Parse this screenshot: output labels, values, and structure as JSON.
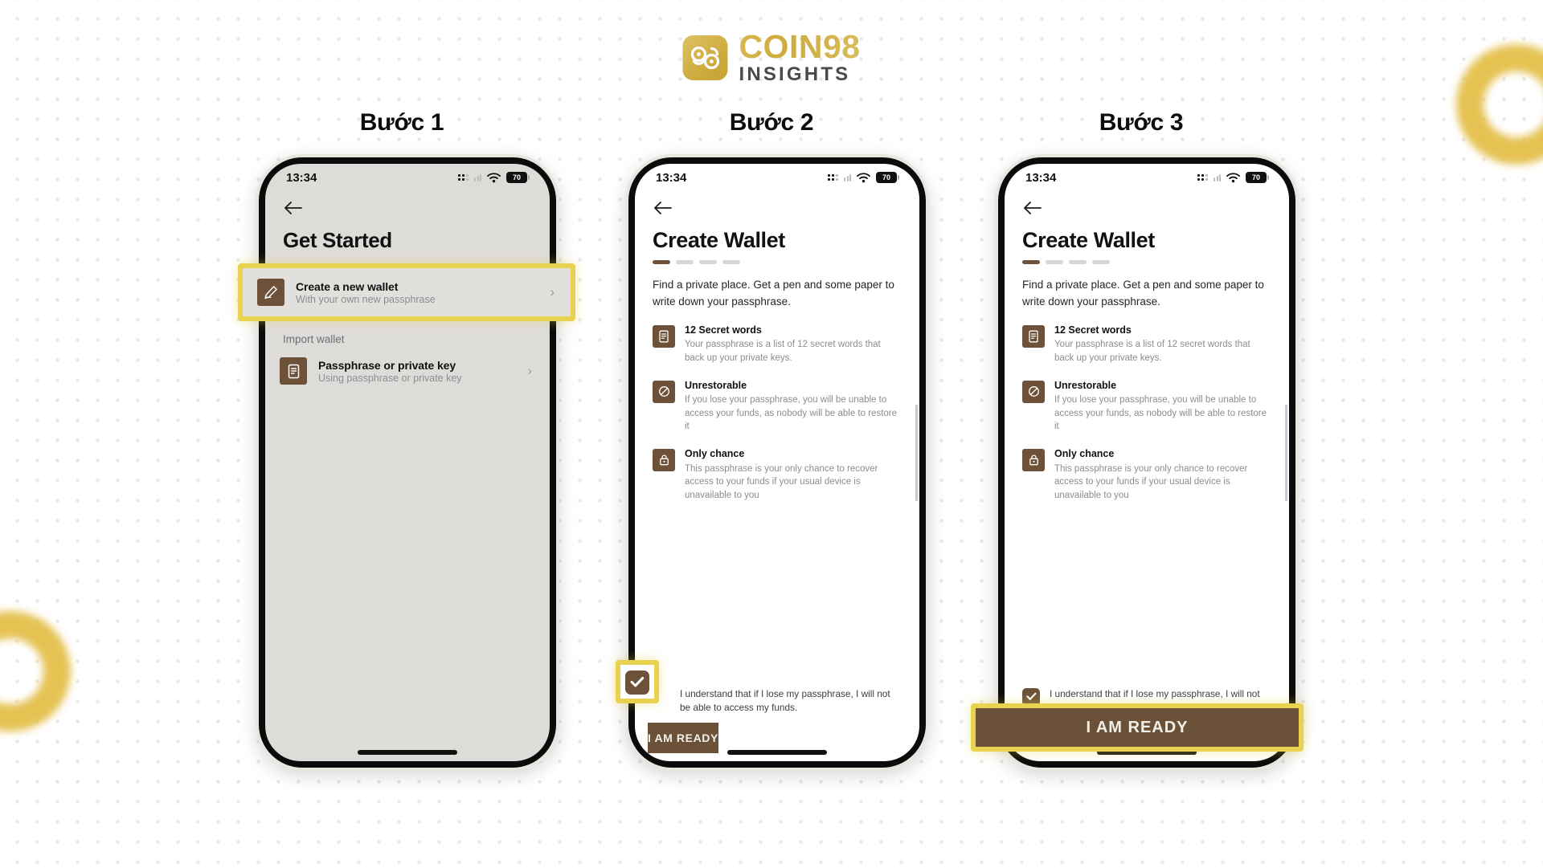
{
  "brand": {
    "name": "COIN98",
    "subtitle": "INSIGHTS",
    "logo_icon": "coin98-logo-icon",
    "gold": "#cfac3f"
  },
  "colors": {
    "brown": "#6d5239",
    "cta_brown": "#6b5138",
    "highlight_yellow": "#e9d24f",
    "screen_gray": "#dedcd8",
    "muted_text": "#8c8c92"
  },
  "steps": [
    {
      "label": "Bước 1"
    },
    {
      "label": "Bước 2"
    },
    {
      "label": "Bước 3"
    }
  ],
  "status_bar": {
    "time": "13:34",
    "battery": "70",
    "signal_icon": "signal-dots-icon",
    "wifi_icon": "wifi-icon",
    "battery_icon": "battery-icon"
  },
  "screen1": {
    "back_icon": "back-arrow-icon",
    "title": "Get Started",
    "primary_row": {
      "icon": "pencil-icon",
      "title": "Create a new wallet",
      "subtitle": "With your own new passphrase",
      "chevron": "›"
    },
    "section_label": "Import wallet",
    "import_row": {
      "icon": "document-icon",
      "title": "Passphrase or private key",
      "subtitle": "Using passphrase or private key",
      "chevron": "›"
    }
  },
  "screen2": {
    "back_icon": "back-arrow-icon",
    "title": "Create Wallet",
    "progress": {
      "total": 4,
      "active": 1
    },
    "intro": "Find a private place. Get a pen and some paper to write down your passphrase.",
    "features": [
      {
        "icon": "list-document-icon",
        "title": "12 Secret words",
        "desc": "Your passphrase is a list of 12 secret words that back up your private keys."
      },
      {
        "icon": "no-entry-icon",
        "title": "Unrestorable",
        "desc": "If you lose your passphrase, you will be unable to access your funds, as nobody will be able to restore it"
      },
      {
        "icon": "lock-icon",
        "title": "Only chance",
        "desc": "This passphrase is your only chance to recover access to your funds if your usual device is unavailable to you"
      }
    ],
    "consent_text": "I understand that if I lose my passphrase, I will not be able to access my funds.",
    "consent_checked": true,
    "cta_label": "I AM READY"
  },
  "screen3": {
    "back_icon": "back-arrow-icon",
    "title": "Create Wallet",
    "progress": {
      "total": 4,
      "active": 1
    },
    "intro": "Find a private place. Get a pen and some paper to write down your passphrase.",
    "features": [
      {
        "icon": "list-document-icon",
        "title": "12 Secret words",
        "desc": "Your passphrase is a list of 12 secret words that back up your private keys."
      },
      {
        "icon": "no-entry-icon",
        "title": "Unrestorable",
        "desc": "If you lose your passphrase, you will be unable to access your funds, as nobody will be able to restore it"
      },
      {
        "icon": "lock-icon",
        "title": "Only chance",
        "desc": "This passphrase is your only chance to recover access to your funds if your usual device is unavailable to you"
      }
    ],
    "consent_text": "I understand that if I lose my passphrase, I will not be able to access my funds.",
    "consent_checked": true,
    "cta_label": "I AM READY"
  },
  "highlights": {
    "step1_target": "create-a-new-wallet-row",
    "step2_target": "consent-checkbox",
    "step3_target": "i-am-ready-button"
  }
}
